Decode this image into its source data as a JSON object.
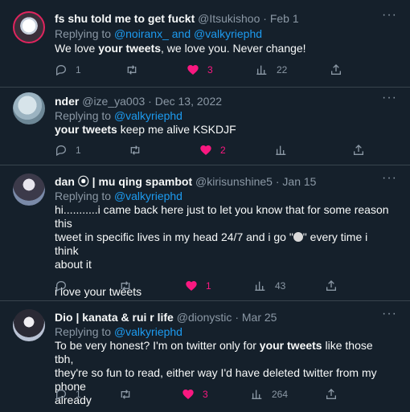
{
  "tweets": [
    {
      "name": "fs shu told me to get fuckt",
      "handle": "@Itsukishoo",
      "date": "Feb 1",
      "replying_prefix": "Replying to",
      "replying_to": "@noiranx_ and @valkyriephd",
      "text_parts": [
        "We love ",
        "your tweets",
        ", we love you. Never change!"
      ],
      "replies": "1",
      "retweets": "",
      "likes": "3",
      "views": "22"
    },
    {
      "name": "nder",
      "handle": "@ize_ya003",
      "date": "Dec 13, 2022",
      "replying_prefix": "Replying to",
      "replying_to": "@valkyriephd",
      "text_parts": [
        "your tweets",
        " keep me alive KSKDJF"
      ],
      "replies": "1",
      "retweets": "",
      "likes": "2",
      "views": ""
    },
    {
      "name": "dan ⦿ | mu qing spambot",
      "handle": "@kirisunshine5",
      "date": "Jan 15",
      "replying_prefix": "Replying to",
      "replying_to": "@valkyriephd",
      "text_line1": "hi...........i came back here just to let you know that for some reason this",
      "text_line2a": "tweet in specific lives in my head 24/7 and i go \"",
      "text_line2b": "\" every time i think",
      "text_line3": "about it",
      "text_line4": "i love your tweets",
      "replies": "",
      "retweets": "",
      "likes": "1",
      "views": "43"
    },
    {
      "name": "Dio | kanata & rui r life",
      "handle": "@dionystic",
      "date": "Mar 25",
      "replying_prefix": "Replying to",
      "replying_to": "@valkyriephd",
      "text_line1a": "To be very honest? I'm on twitter only for ",
      "text_line1b": "your tweets",
      "text_line1c": " like those tbh,",
      "text_line2": "they're so fun to read, either way I'd have deleted twitter from my phone",
      "text_line3": "already",
      "replies": "1",
      "retweets": "",
      "likes": "3",
      "views": "264"
    }
  ],
  "separator": "·",
  "more_label": "···",
  "colors": {
    "background": "#15202b",
    "link": "#1d9bf0",
    "like": "#f91880",
    "muted": "#8b98a5"
  }
}
